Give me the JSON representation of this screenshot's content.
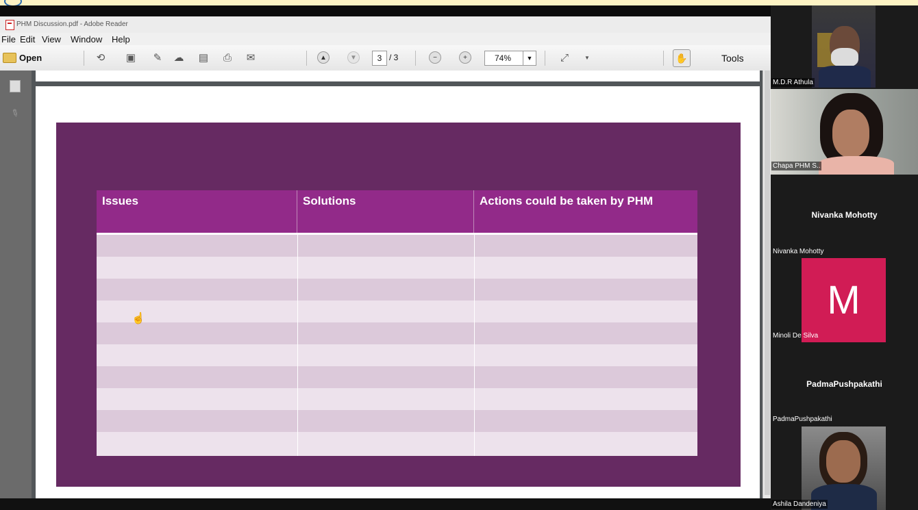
{
  "window": {
    "title": "PHM Discussion.pdf - Adobe Reader"
  },
  "menu": [
    "File",
    "Edit",
    "View",
    "Window",
    "Help"
  ],
  "toolbar": {
    "open_label": "Open",
    "page_current": "3",
    "page_total": "/ 3",
    "zoom": "74%",
    "tools_label": "Tools"
  },
  "table": {
    "headers": [
      "Issues",
      "Solutions",
      "Actions could be taken by PHM"
    ],
    "row_count": 10
  },
  "participants": [
    {
      "name": "M.D.R Athula",
      "video": true
    },
    {
      "name": "Chapa PHM S..",
      "video": true
    },
    {
      "name": "Nivanka Mohotty",
      "display": "Nivanka Mohotty",
      "video": false
    },
    {
      "name": "Minoli De Silva",
      "initial": "M",
      "video": false
    },
    {
      "name": "PadmaPushpakathi",
      "display": "PadmaPushpakathi",
      "video": false
    },
    {
      "name": "Ashila Dandeniya",
      "video": true
    }
  ],
  "colors": {
    "slide_bg": "#662a62",
    "header_bg": "#922a89",
    "row_dark": "#dcc9da",
    "row_light": "#ede2ec",
    "avatar_bg": "#d11c55"
  }
}
